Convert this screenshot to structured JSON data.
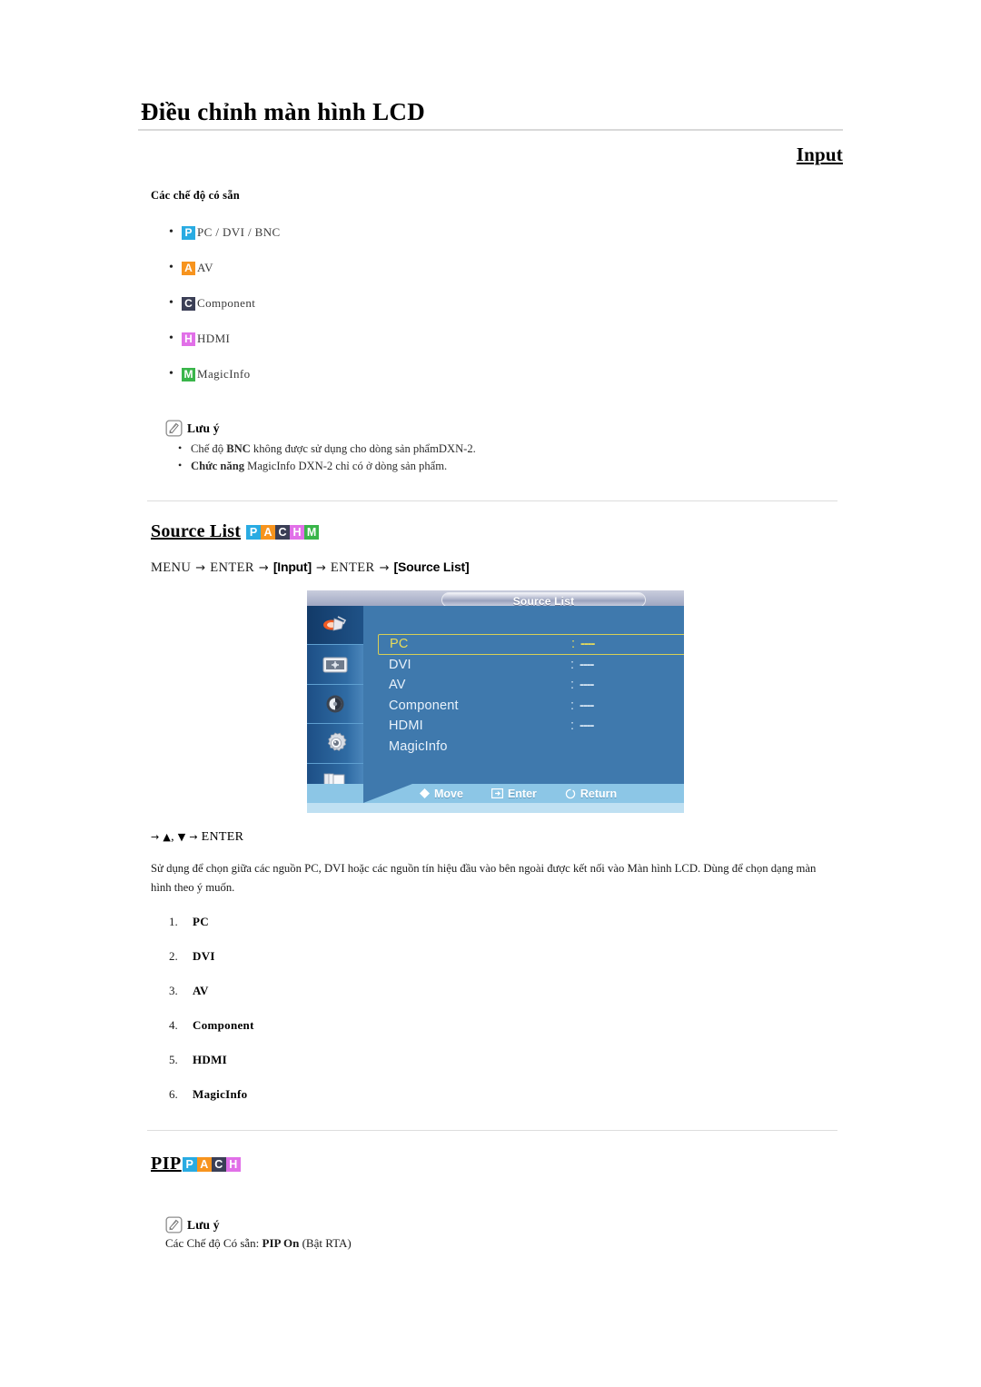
{
  "header": {
    "doc_title": "Điều chỉnh màn hình LCD",
    "section_title": "Input"
  },
  "available_modes": {
    "heading": "Các chế độ có sẵn",
    "items": [
      {
        "badge": "P",
        "color": "#29abe2",
        "label": "PC / DVI / BNC"
      },
      {
        "badge": "A",
        "color": "#f7941e",
        "label": "AV"
      },
      {
        "badge": "C",
        "color": "#3b3f56",
        "label": "Component"
      },
      {
        "badge": "H",
        "color": "#e170e8",
        "label": "HDMI"
      },
      {
        "badge": "M",
        "color": "#39b54a",
        "label": "MagicInfo"
      }
    ]
  },
  "note_input": {
    "icon": "note-pencil-icon",
    "title": "Lưu ý",
    "items": [
      {
        "bold": "",
        "pre": "Chế độ ",
        "strong": "BNC",
        "post": " không được sử dụng cho dòng sản phẩmDXN-2."
      },
      {
        "bold": "",
        "pre": "",
        "strong": "Chức năng",
        "post": " MagicInfo DXN-2 chỉ có ở dòng sản phẩm."
      }
    ],
    "line1_pre": "Chế độ ",
    "line1_strong": "BNC",
    "line1_post": " không được sử dụng cho dòng sản phẩmDXN-2.",
    "line2_strong": "Chức năng",
    "line2_post": " MagicInfo DXN-2 chỉ có ở dòng sản phẩm."
  },
  "source_list_section": {
    "title": "Source List",
    "badges": [
      {
        "letter": "P",
        "color": "#29abe2"
      },
      {
        "letter": "A",
        "color": "#f7941e"
      },
      {
        "letter": "C",
        "color": "#3b3f56"
      },
      {
        "letter": "H",
        "color": "#e170e8"
      },
      {
        "letter": "M",
        "color": "#39b54a"
      }
    ],
    "menu_path": {
      "step1": "MENU",
      "arrow1": "→",
      "step2": "ENTER",
      "arrow2": "→",
      "step3": "[Input]",
      "arrow3": "→",
      "step4": "ENTER",
      "arrow4": "→",
      "step5": "[Source List]"
    },
    "key_sequence": {
      "arrow_start": "→",
      "up": "▲",
      "comma": ",",
      "down": "▼",
      "arrow_end": "→",
      "enter": "ENTER"
    },
    "description": "Sử dụng để chọn giữa các nguồn PC, DVI hoặc các nguồn tín hiệu đầu vào bên ngoài được kết nối vào Màn hình LCD. Dùng để chọn dạng màn hình theo ý muốn.",
    "numbered_items": [
      {
        "n": "1.",
        "label": "PC"
      },
      {
        "n": "2.",
        "label": "DVI"
      },
      {
        "n": "3.",
        "label": "AV"
      },
      {
        "n": "4.",
        "label": "Component"
      },
      {
        "n": "5.",
        "label": "HDMI"
      },
      {
        "n": "6.",
        "label": "MagicInfo"
      }
    ]
  },
  "osd": {
    "title": "Source List",
    "sidebar_icons": [
      "picture-icon",
      "screen-adjust-icon",
      "sound-icon",
      "setup-gear-icon",
      "multi-control-icon"
    ],
    "rows": [
      {
        "label": "PC",
        "colon": ":",
        "value": "----",
        "selected": true
      },
      {
        "label": "DVI",
        "colon": ":",
        "value": "----",
        "selected": false
      },
      {
        "label": "AV",
        "colon": ":",
        "value": "----",
        "selected": false
      },
      {
        "label": "Component",
        "colon": ":",
        "value": "----",
        "selected": false
      },
      {
        "label": "HDMI",
        "colon": ":",
        "value": "----",
        "selected": false
      },
      {
        "label": "MagicInfo",
        "colon": "",
        "value": "",
        "selected": false
      }
    ],
    "hints": [
      {
        "icon": "move-diamond-icon",
        "label": "Move"
      },
      {
        "icon": "enter-icon",
        "label": "Enter"
      },
      {
        "icon": "return-icon",
        "label": "Return"
      }
    ],
    "colors": {
      "panel": "#3f79ad",
      "sidebar": "#2f6ba3",
      "selected_text": "#e8dc5a",
      "bottom_bar": "#8cc6e6"
    }
  },
  "pip_section": {
    "title": "PIP",
    "badges": [
      {
        "letter": "P",
        "color": "#29abe2"
      },
      {
        "letter": "A",
        "color": "#f7941e"
      },
      {
        "letter": "C",
        "color": "#3b3f56"
      },
      {
        "letter": "H",
        "color": "#e170e8"
      }
    ],
    "note": {
      "title": "Lưu ý",
      "line_pre": "Các Chế độ Có sẵn: ",
      "line_strong": "PIP On",
      "line_post": " (Bật RTA)"
    }
  }
}
